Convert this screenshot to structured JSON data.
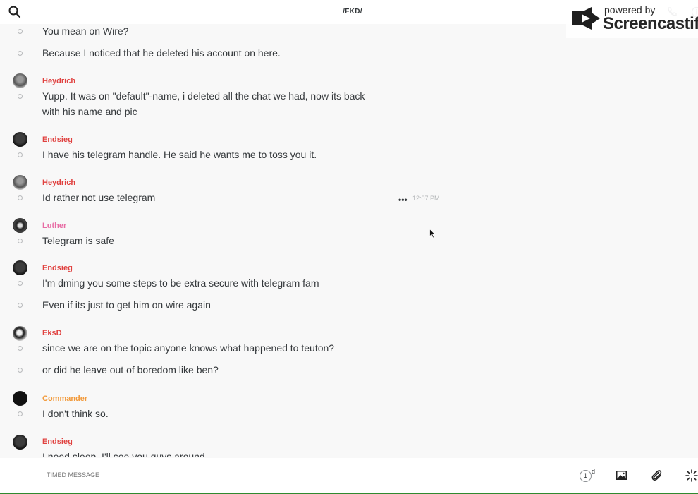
{
  "header": {
    "title": "/FKD/",
    "search_icon": "search-icon",
    "call_icon": "phone-icon",
    "info_icon": "info-icon"
  },
  "watermark": {
    "small_text": "powered by",
    "big_text": "Screencastify"
  },
  "colors": {
    "red_user": "#e0413f",
    "pink_user": "#e76ca4",
    "orange_user": "#f29a3b",
    "text": "#34383b",
    "muted": "#b3b6b8"
  },
  "messages": [
    {
      "sender": "",
      "text": "You mean on Wire?"
    },
    {
      "sender": "",
      "text": "Because I noticed that he deleted his account on here."
    },
    {
      "sender": "Heydrich",
      "text": "Yupp. It was on \"default\"-name, i deleted all the chat we had, now its back with his name and pic"
    },
    {
      "sender": "Endsieg",
      "text": "I have his telegram handle. He said he wants me to toss you it."
    },
    {
      "sender": "Heydrich",
      "text": "Id rather not use telegram",
      "time": "12:07 PM",
      "more": "•••"
    },
    {
      "sender": "Luther",
      "text": "Telegram is safe"
    },
    {
      "sender": "Endsieg",
      "text": "I'm dming you some steps to be extra secure with telegram fam"
    },
    {
      "sender": "",
      "text": "Even if its just to get him on wire again"
    },
    {
      "sender": "EksD",
      "text": "since we are on the topic anyone knows what happened to teuton?"
    },
    {
      "sender": "",
      "text": "or did he leave out of boredom like ben?"
    },
    {
      "sender": "Commander",
      "text": "I don't think so."
    },
    {
      "sender": "Endsieg",
      "text": "I need sleep. I'll see you guys around"
    }
  ],
  "footer": {
    "input_placeholder": "TIMED MESSAGE",
    "timer_value": "1",
    "timer_unit": "d"
  }
}
